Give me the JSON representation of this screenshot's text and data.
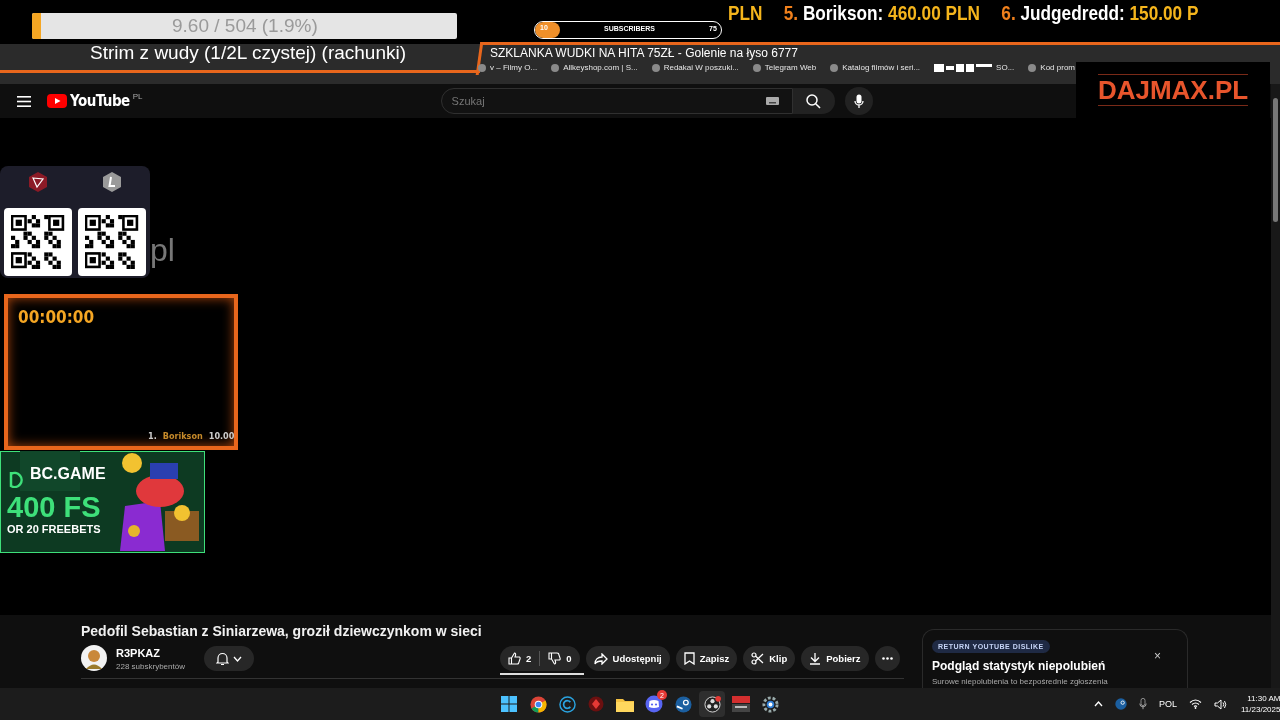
{
  "goal": {
    "progress": "9.60 / 504 (1.9%)",
    "level": 0.019,
    "title": "Strim z wudy (1/2L czystej) (rachunki)"
  },
  "subscriber_goal": {
    "current": "10",
    "label": "SUBSCRIBERS",
    "target": "75",
    "level": 0.133
  },
  "ticker": [
    {
      "amount": "PLN"
    },
    {
      "rank": "5.",
      "name": "Borikson:",
      "amount": "460.00 PLN"
    },
    {
      "rank": "6.",
      "name": "Judgedredd:",
      "amount": "150.00 P"
    }
  ],
  "banner": "SZKLANKA WUDKI NA HITA 75ZŁ - Golenie na łyso 6777",
  "bookmarks": [
    "v – Filmy O...",
    "Allkeyshop.com | S...",
    "Redakai W poszuki...",
    "Telegram Web",
    "Katalog filmów i seri...",
    "SO...",
    "Kod prom"
  ],
  "youtube": {
    "logo": "YouTube",
    "region": "PL",
    "search_placeholder": "Szukaj"
  },
  "sponsor": "DAJMAX.PL",
  "partial_text": "pl",
  "timer": {
    "time": "00:00:00",
    "rank": "1.",
    "name": "Borikson",
    "amount": "10.00"
  },
  "ad": {
    "brand": "BC.GAME",
    "headline": "400 FS",
    "subline": "OR 20 FREEBETS"
  },
  "video": {
    "title": "Pedofil Sebastian z Siniarzewa, groził dziewczynkom w sieci",
    "channel": "R3PKAZ",
    "subscribers": "228 subskrybentów",
    "likes": "2",
    "dislikes": "0",
    "actions": [
      {
        "kind": "share",
        "label": "Udostępnij"
      },
      {
        "kind": "save",
        "label": "Zapisz"
      },
      {
        "kind": "clip",
        "label": "Klip"
      },
      {
        "kind": "download",
        "label": "Pobierz"
      }
    ]
  },
  "ryd_card": {
    "badge": "RETURN YOUTUBE DISLIKE",
    "title": "Podgląd statystyk niepolubień",
    "text": "Surowe niepolubienia to bezpośrednie zgłoszenia",
    "close": "×"
  },
  "taskbar": {
    "apps": [
      {
        "kind": "windows"
      },
      {
        "kind": "chrome"
      },
      {
        "kind": "c"
      },
      {
        "kind": "red"
      },
      {
        "kind": "folder"
      },
      {
        "kind": "discord",
        "badge": "2"
      },
      {
        "kind": "steam"
      },
      {
        "kind": "obs"
      },
      {
        "kind": "voicemeeter"
      },
      {
        "kind": "gear"
      }
    ],
    "language": "POL",
    "time": "11:30 AM",
    "date": "11/23/2025"
  }
}
